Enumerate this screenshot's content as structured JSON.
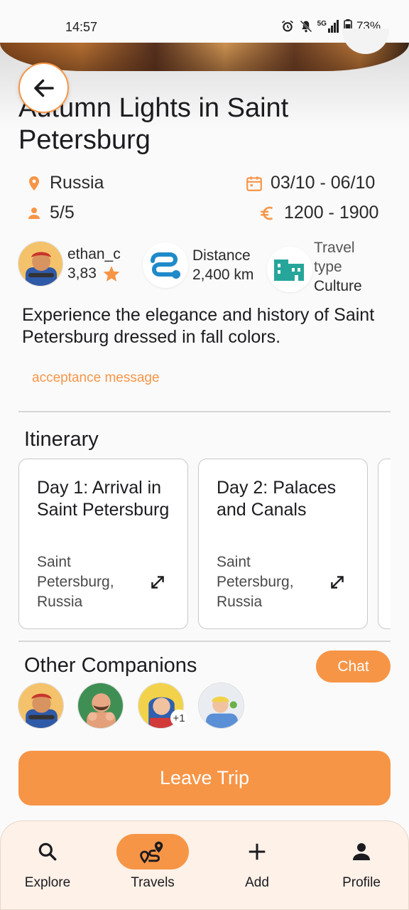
{
  "status_bar": {
    "time": "14:57",
    "battery": "73%",
    "network": "5G"
  },
  "trip": {
    "title": "Autumn Lights in Saint Petersburg",
    "country": "Russia",
    "dates": "03/10 - 06/10",
    "participants": "5/5",
    "price": "1200 - 1900",
    "description": "Experience the elegance and history of Saint Petersburg dressed in fall colors.",
    "acceptance_message": "acceptance message"
  },
  "organizer": {
    "username": "ethan_c",
    "rating": "3,83"
  },
  "stats": {
    "distance_label": "Distance",
    "distance_value": "2,400 km",
    "travel_type_label": "Travel type",
    "travel_type_value": "Culture"
  },
  "itinerary": {
    "title": "Itinerary",
    "days": [
      {
        "title": "Day 1: Arrival in Saint Petersburg",
        "location": "Saint Petersburg, Russia"
      },
      {
        "title": "Day 2: Palaces and Canals",
        "location": "Saint Petersburg, Russia"
      }
    ]
  },
  "companions": {
    "title": "Other Companions",
    "chat_label": "Chat",
    "extra_count": "+1"
  },
  "actions": {
    "leave_label": "Leave Trip"
  },
  "nav": {
    "items": [
      {
        "label": "Explore"
      },
      {
        "label": "Travels"
      },
      {
        "label": "Add"
      },
      {
        "label": "Profile"
      }
    ]
  },
  "colors": {
    "accent": "#f79546",
    "teal": "#26a69a",
    "nav_background": "#fdf1e8"
  }
}
